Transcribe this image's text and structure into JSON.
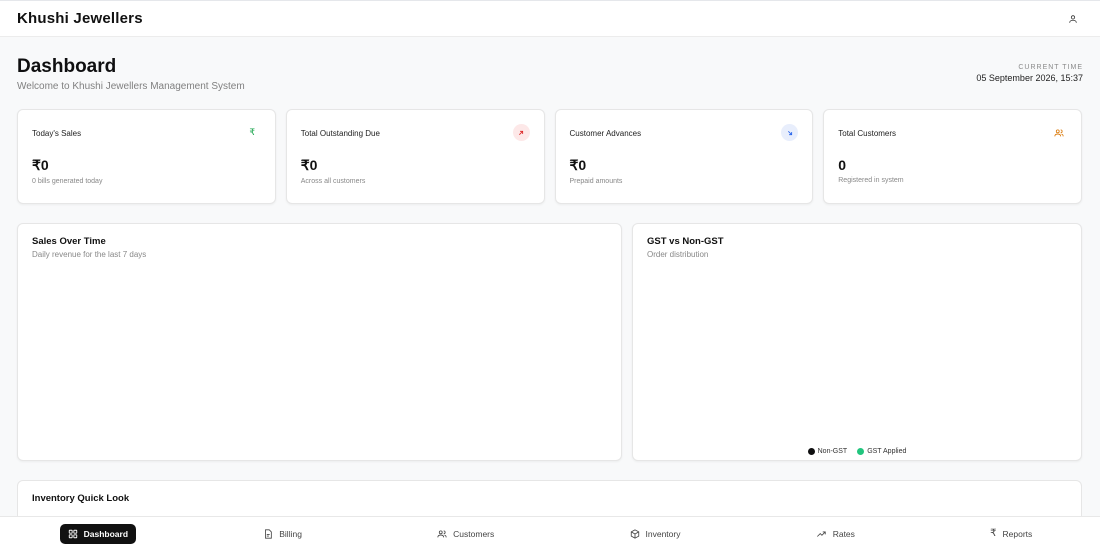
{
  "app": {
    "brand": "Khushi Jewellers"
  },
  "header": {
    "title": "Dashboard",
    "subtitle": "Welcome to Khushi Jewellers Management System",
    "clock_label": "CURRENT TIME",
    "clock_value": "05 September 2026, 15:37"
  },
  "stats": [
    {
      "title": "Today's Sales",
      "value": "₹0",
      "note": "0 bills generated today",
      "icon": "rupee-icon",
      "color": "#16a34a"
    },
    {
      "title": "Total Outstanding Due",
      "value": "₹0",
      "note": "Across all customers",
      "icon": "arrow-up-right-icon",
      "color": "#dc2626"
    },
    {
      "title": "Customer Advances",
      "value": "₹0",
      "note": "Prepaid amounts",
      "icon": "arrow-down-right-icon",
      "color": "#2563eb"
    },
    {
      "title": "Total Customers",
      "value": "0",
      "note": "Registered in system",
      "icon": "users-icon",
      "color": "#d97706"
    }
  ],
  "sales_panel": {
    "title": "Sales Over Time",
    "subtitle": "Daily revenue for the last 7 days"
  },
  "gst_panel": {
    "title": "GST vs Non-GST",
    "subtitle": "Order distribution",
    "legend": [
      {
        "label": "Non-GST",
        "color": "#0f0f10"
      },
      {
        "label": "GST Applied",
        "color": "#22c57e"
      }
    ]
  },
  "inventory": {
    "title": "Inventory Quick Look"
  },
  "nav": [
    {
      "label": "Dashboard",
      "icon": "dashboard-icon",
      "active": true
    },
    {
      "label": "Billing",
      "icon": "receipt-icon",
      "active": false
    },
    {
      "label": "Customers",
      "icon": "users-icon",
      "active": false
    },
    {
      "label": "Inventory",
      "icon": "box-icon",
      "active": false
    },
    {
      "label": "Rates",
      "icon": "trend-icon",
      "active": false
    },
    {
      "label": "Reports",
      "icon": "rupee-icon",
      "active": false
    }
  ]
}
